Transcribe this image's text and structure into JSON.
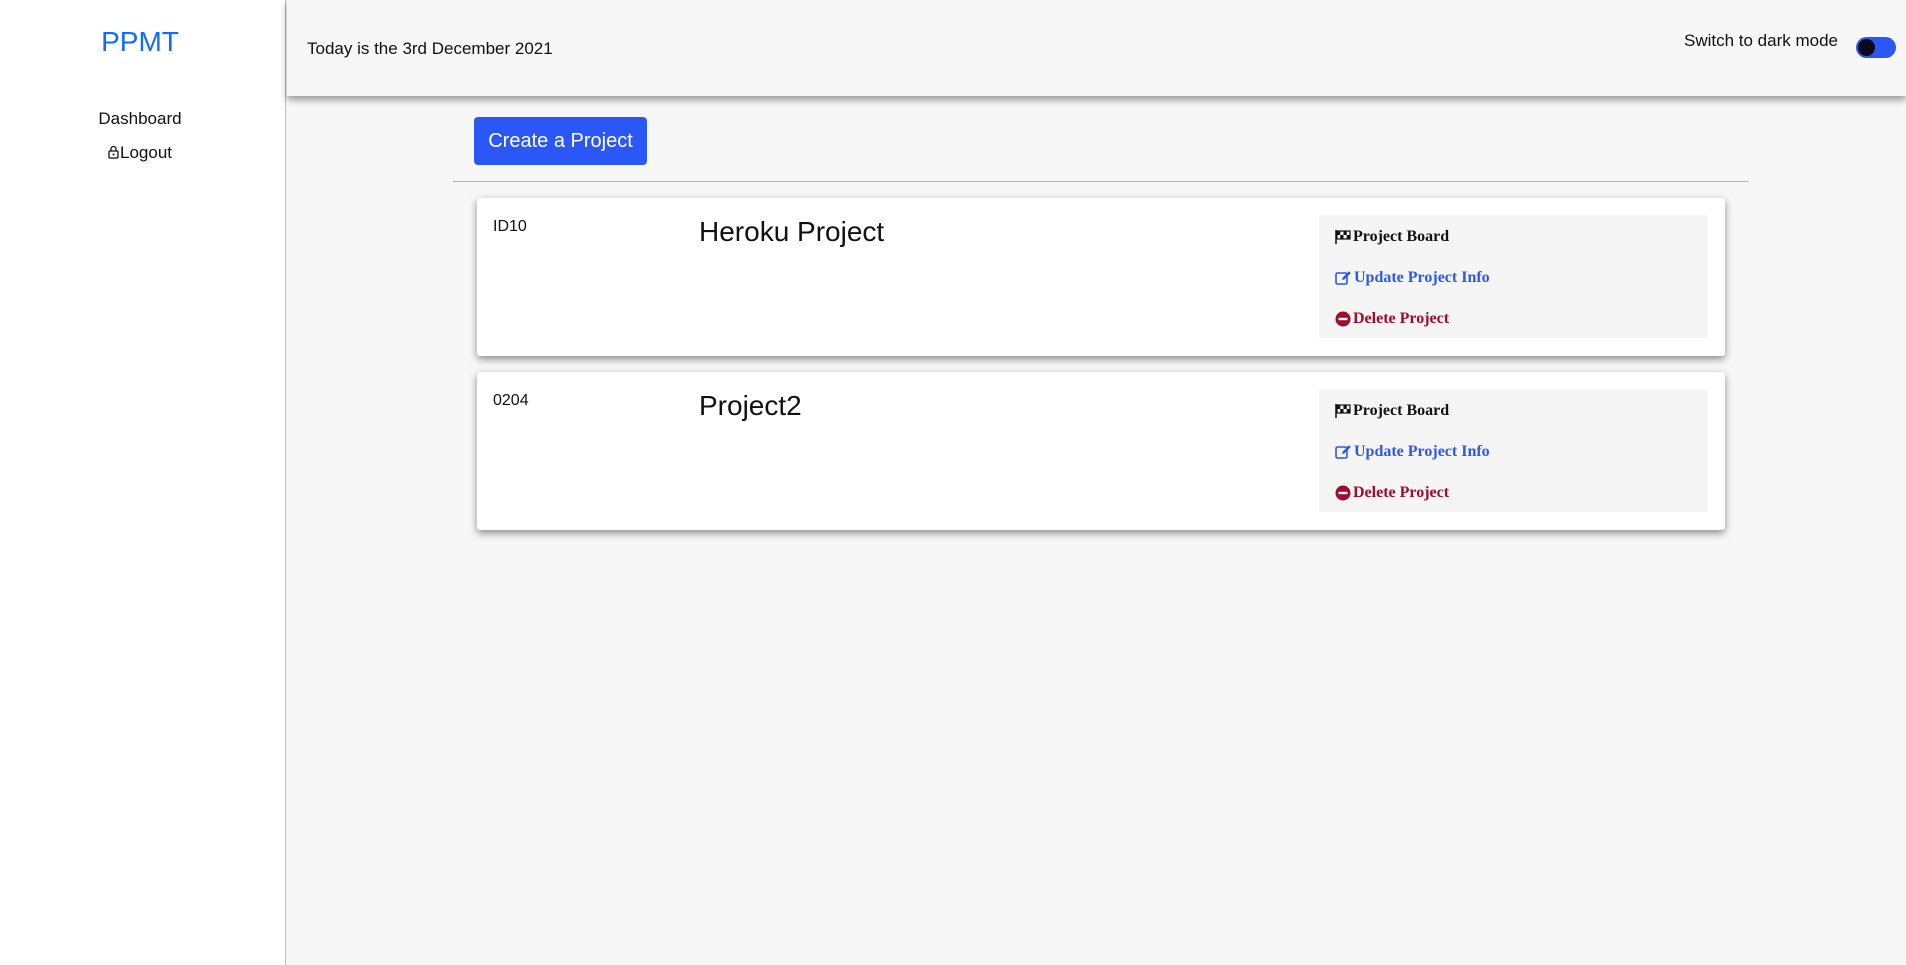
{
  "sidebar": {
    "brand": "PPMT",
    "items": [
      {
        "label": "Dashboard",
        "icon": ""
      },
      {
        "label": "Logout",
        "icon": "lock-icon"
      }
    ]
  },
  "header": {
    "date_text": "Today is the 3rd December 2021",
    "dark_mode_label": "Switch to dark mode",
    "dark_mode_on": false
  },
  "toolbar": {
    "create_label": "Create a Project"
  },
  "projects": [
    {
      "id": "ID10",
      "name": "Heroku Project",
      "actions": {
        "board": "Project Board",
        "update": "Update Project Info",
        "delete": "Delete Project"
      }
    },
    {
      "id": "0204",
      "name": "Project2",
      "actions": {
        "board": "Project Board",
        "update": "Update Project Info",
        "delete": "Delete Project"
      }
    }
  ],
  "colors": {
    "brand": "#0d6efd",
    "primary": "#2a57f5",
    "danger": "#a30b2b"
  }
}
